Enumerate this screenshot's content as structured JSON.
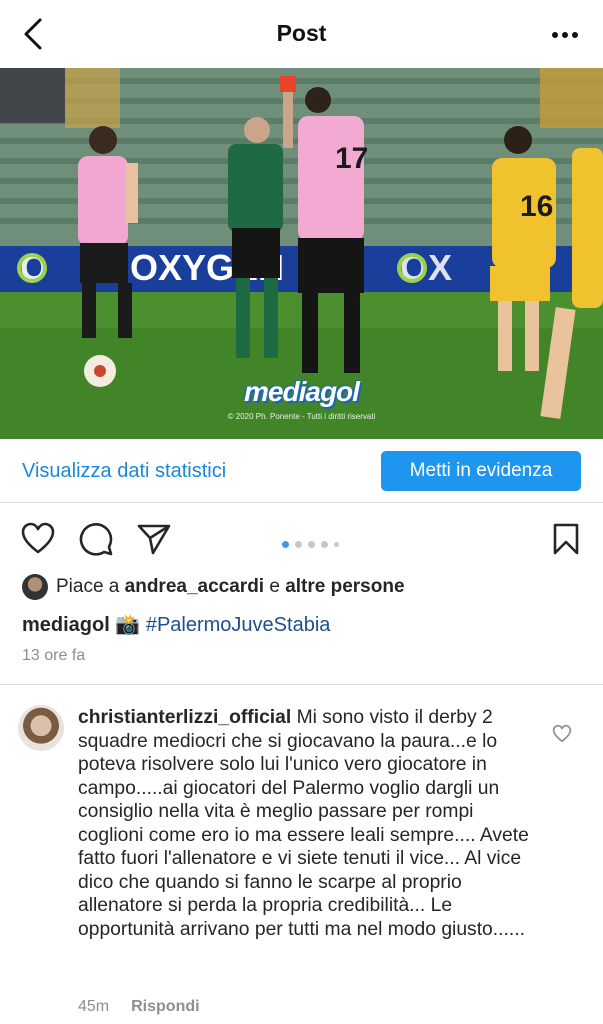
{
  "header": {
    "title": "Post",
    "back_icon": "chevron-left-icon",
    "more_icon": "more-horizontal-icon"
  },
  "photo": {
    "board_text": "OXYGEN",
    "watermark": "mediagol",
    "credit": "© 2020 Ph. Ponente - Tutti i diritti riservati",
    "player_numbers": [
      "17",
      "16"
    ]
  },
  "insights": {
    "link_label": "Visualizza dati statistici",
    "promote_label": "Metti in evidenza"
  },
  "actions": {
    "icons": [
      "heart-icon",
      "comment-icon",
      "share-icon",
      "bookmark-icon"
    ],
    "carousel_dots": 5,
    "carousel_active": 1
  },
  "likes": {
    "prefix": "Piace a ",
    "user": "andrea_accardi",
    "connector": " e ",
    "others": "altre persone"
  },
  "caption": {
    "user": "mediagol",
    "emoji": "📸",
    "hashtag": "#PalermoJuveStabia"
  },
  "post_time": "13 ore fa",
  "comment": {
    "user": "christianterlizzi_official",
    "text": "Mi sono visto il derby 2 squadre mediocri che si giocavano la paura...e lo poteva risolvere solo lui l'unico vero giocatore in campo.....ai giocatori del Palermo voglio dargli un consiglio nella vita è meglio passare per rompi coglioni come ero io ma essere leali sempre.... Avete fatto fuori l'allenatore e vi siete tenuti il vice... Al vice dico che quando si fanno le scarpe al proprio allenatore si perda la propria credibilità... Le opportunità arrivano per tutti ma nel modo giusto......",
    "time": "45m",
    "reply_label": "Rispondi"
  },
  "colors": {
    "accent": "#1e95ee",
    "link": "#1b87d8",
    "hashtag": "#1d4f91",
    "muted": "#8e8e8e"
  }
}
